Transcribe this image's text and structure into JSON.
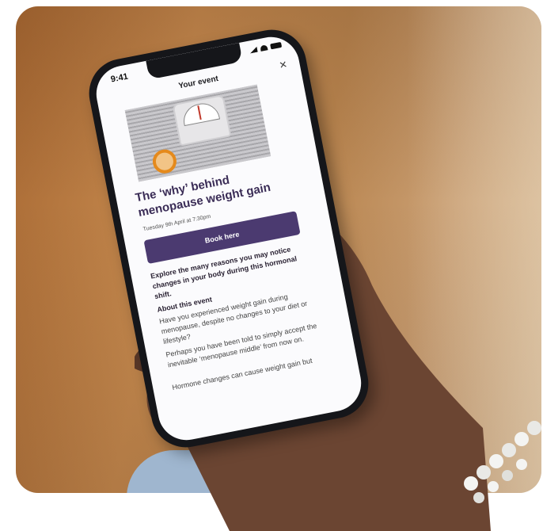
{
  "status_bar": {
    "time": "9:41"
  },
  "nav": {
    "title": "Your event",
    "close_label": "×"
  },
  "event": {
    "title": "The ‘why’ behind menopause weight gain",
    "date": "Tuesday 9th April at 7:30pm",
    "book_label": "Book here",
    "lead": "Explore the many reasons you may notice changes in your body during this hormonal shift.",
    "about_heading": "About this event",
    "paragraphs": [
      "Have you experienced weight gain during menopause, despite no changes to your diet or lifestyle?",
      "Perhaps you have been told to simply accept the inevitable ‘menopause middle’ from now on.",
      "Hormone changes can cause weight gain but"
    ]
  },
  "colors": {
    "brand": "#4b3a70",
    "title": "#3a2c56"
  }
}
